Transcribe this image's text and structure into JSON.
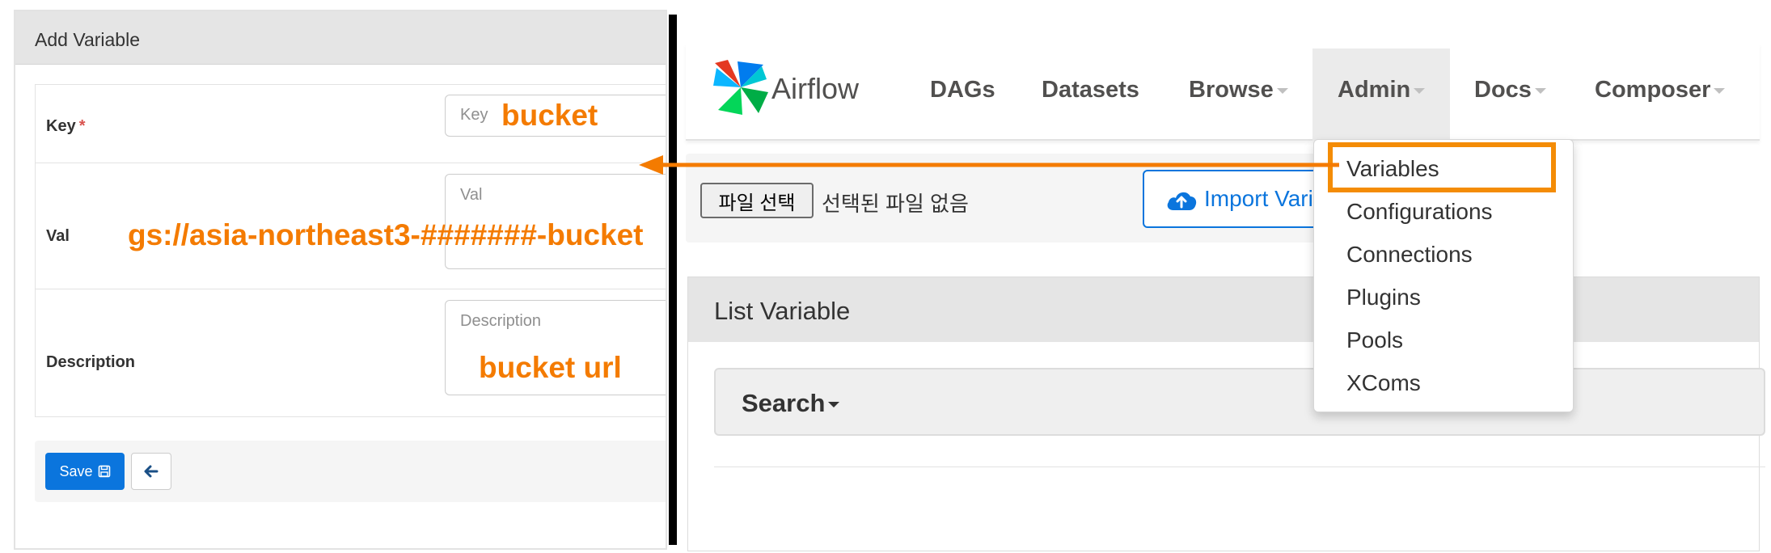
{
  "add_variable": {
    "title": "Add Variable",
    "fields": {
      "key": {
        "label": "Key",
        "required_mark": "*",
        "placeholder": "Key"
      },
      "val": {
        "label": "Val",
        "placeholder": "Val"
      },
      "description": {
        "label": "Description",
        "placeholder": "Description"
      }
    },
    "save_label": "Save"
  },
  "annotations": {
    "key_value": "bucket",
    "val_value": "gs://asia-northeast3-#######-bucket",
    "description_value": "bucket url",
    "color": "#f47b00"
  },
  "airflow": {
    "brand": "Airflow",
    "nav": {
      "dags": "DAGs",
      "datasets": "Datasets",
      "browse": "Browse",
      "admin": "Admin",
      "docs": "Docs",
      "composer": "Composer"
    },
    "file": {
      "choose_label": "파일 선택",
      "status": "선택된 파일 없음"
    },
    "import_label": "Import Vari",
    "list_title": "List Variable",
    "search_label": "Search",
    "admin_menu": [
      "Variables",
      "Configurations",
      "Connections",
      "Plugins",
      "Pools",
      "XComs"
    ]
  },
  "colors": {
    "primary": "#0b75dd",
    "highlight": "#f48c06",
    "required": "#d9534f"
  },
  "icons": [
    "floppy-disk-icon",
    "arrow-left-icon",
    "cloud-upload-icon",
    "airflow-pinwheel-logo-icon",
    "caret-down-icon"
  ]
}
